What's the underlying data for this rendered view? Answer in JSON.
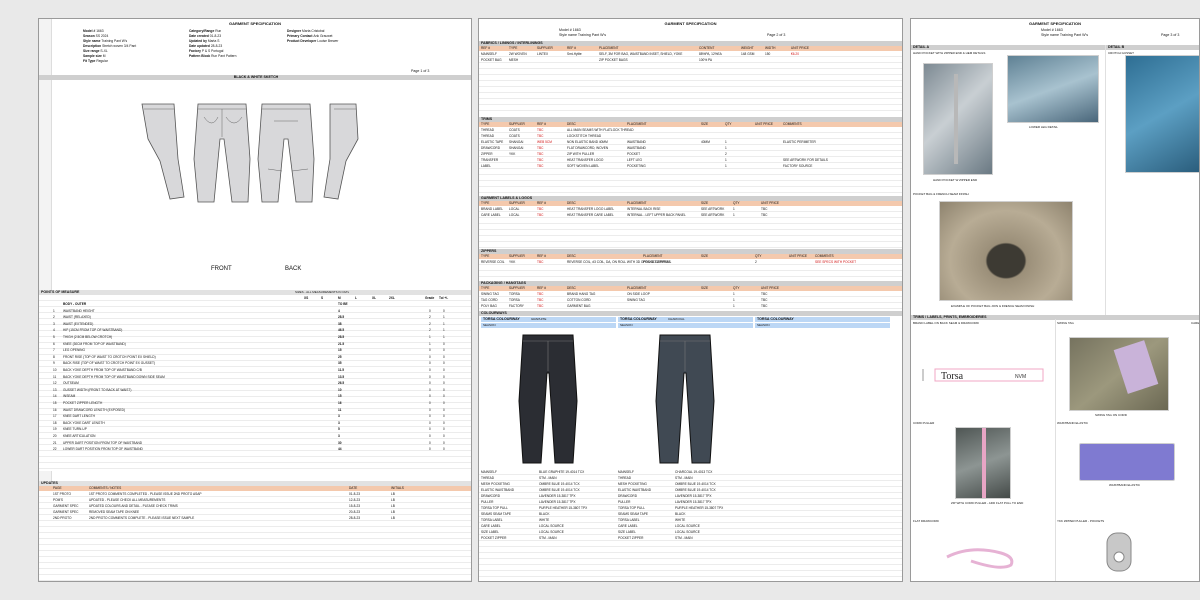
{
  "sheet1": {
    "title": "GARMENT SPECIFICATION",
    "meta": [
      {
        "label": "Model #",
        "value": "1663"
      },
      {
        "label": "Season",
        "value": "SS 2024"
      },
      {
        "label": "Style name",
        "value": "Training Pant W's"
      },
      {
        "label": "Description",
        "value": "Stretch woven 3/4 Pant"
      },
      {
        "label": "Size range",
        "value": "S-XL"
      },
      {
        "label": "Sample size",
        "value": "M"
      },
      {
        "label": "Fit Type",
        "value": "Regular"
      }
    ],
    "meta2": [
      {
        "label": "Category/Range",
        "value": "Run"
      },
      {
        "label": "Date created",
        "value": "01-8-23"
      },
      {
        "label": "Updated by",
        "value": "Marta S"
      },
      {
        "label": "Date updated",
        "value": "28-8-23"
      },
      {
        "label": "Factory",
        "value": "P & S Portugal"
      },
      {
        "label": "Pattern Block",
        "value": "Run Pant Pattern"
      }
    ],
    "meta3": [
      {
        "label": "Designer",
        "value": "Marta Cristobal"
      },
      {
        "label": "Primary Contact",
        "value": "Ank Grauwet"
      },
      {
        "label": "Product Developer",
        "value": "Louise Brewer"
      }
    ],
    "page": "Page 1 of 3",
    "sketch_title": "BLACK & WHITE SKETCH",
    "front_label": "FRONT",
    "back_label": "BACK",
    "pom_title": "POINTS OF MEASURE",
    "sizes_title": "SIZES - ALL MEASUREMENTS IN CM's",
    "size_headers": [
      "XS",
      "S",
      "M",
      "L",
      "XL",
      "2XL"
    ],
    "grade_header": "Grade",
    "tol_header": "Tol +/-",
    "pom_items": [
      {
        "n": "",
        "desc": "BODY - OUTER",
        "m": "TO BE",
        "g": "",
        "t": ""
      },
      {
        "n": "1",
        "desc": "WAISTBAND HEIGHT",
        "m": "4",
        "g": "0",
        "t": "0"
      },
      {
        "n": "2",
        "desc": "WAIST (RELAXED)",
        "m": "28.5",
        "g": "2",
        "t": "1"
      },
      {
        "n": "3",
        "desc": "WAIST (EXTENDED)",
        "m": "38",
        "g": "2",
        "t": "1"
      },
      {
        "n": "4",
        "desc": "HIP (15CM FROM TOP OF WAISTBAND)",
        "m": "46.5",
        "g": "2",
        "t": "1"
      },
      {
        "n": "5",
        "desc": "THIGH (2.5CM BELOW CROTCH)",
        "m": "28.5",
        "g": "1",
        "t": "1"
      },
      {
        "n": "6",
        "desc": "KNEE (30CM FROM TOP OF WAISTBAND)",
        "m": "21.5",
        "g": "1",
        "t": "0"
      },
      {
        "n": "7",
        "desc": "LEG OPENING",
        "m": "15",
        "g": "0",
        "t": "0"
      },
      {
        "n": "8",
        "desc": "FRONT RISE (TOP OF WAIST TO CROTCH POINT EX SHIELD)",
        "m": "25",
        "g": "0",
        "t": "0"
      },
      {
        "n": "9",
        "desc": "BACK RISE (TOP OF WAIST TO CROTCH POINT EX GUSSET)",
        "m": "35",
        "g": "0",
        "t": "0"
      },
      {
        "n": "10",
        "desc": "BACK YOKE DEPTH FROM TOP OF WAISTBAND C/B",
        "m": "11.5",
        "g": "0",
        "t": "0"
      },
      {
        "n": "11",
        "desc": "BACK YOKE DEPTH FROM TOP OF WAISTBAND DOWN SIDE SEAM",
        "m": "13.5",
        "g": "0",
        "t": "0"
      },
      {
        "n": "12",
        "desc": "OUTSEAM",
        "m": "26.5",
        "g": "0",
        "t": "0"
      },
      {
        "n": "13",
        "desc": "GUSSET WIDTH (FRONT TO BACK AT WAIST)",
        "m": "10",
        "g": "0",
        "t": "0"
      },
      {
        "n": "14",
        "desc": "INSEAM",
        "m": "15",
        "g": "0",
        "t": "0"
      },
      {
        "n": "15",
        "desc": "POCKET ZIPPER LENGTH",
        "m": "16",
        "g": "0",
        "t": "0"
      },
      {
        "n": "16",
        "desc": "WAIST DRAWCORD LENGTH (EXPOSED)",
        "m": "11",
        "g": "0",
        "t": "0"
      },
      {
        "n": "17",
        "desc": "KNEE DART LENGTH",
        "m": "3",
        "g": "0",
        "t": "0"
      },
      {
        "n": "18",
        "desc": "BACK YOKE DART LENGTH",
        "m": "3",
        "g": "0",
        "t": "0"
      },
      {
        "n": "19",
        "desc": "KNEE TURN-UP",
        "m": "5",
        "g": "0",
        "t": "0"
      },
      {
        "n": "20",
        "desc": "KNEE ARTICULATION",
        "m": "3",
        "g": "0",
        "t": "0"
      },
      {
        "n": "21",
        "desc": "UPPER DART POSITION FROM TOP OF WAISTBAND",
        "m": "30",
        "g": "0",
        "t": "0"
      },
      {
        "n": "22",
        "desc": "LOWER DART POSITION FROM TOP OF WAISTBAND",
        "m": "44",
        "g": "0",
        "t": "0"
      }
    ],
    "updates_title": "UPDATES",
    "updates_headers": [
      "PAGE",
      "COMMENTS / NOTES",
      "DATE",
      "INITIALS"
    ],
    "updates": [
      {
        "page": "1ST PROTO",
        "note": "1ST PROTO COMMENTS COMPLETED - PLEASE ISSUE 2ND PROTO ASAP",
        "date": "01-8-23",
        "init": "LB"
      },
      {
        "page": "POM'S",
        "note": "UPDATED - PLEASE CHECK ALL MEASUREMENTS",
        "date": "12-8-23",
        "init": "LB"
      },
      {
        "page": "GARMENT SPEC",
        "note": "UPDATED COLOURS AND DETAIL - PLEASE CHECK TRIMS",
        "date": "15-8-23",
        "init": "LB"
      },
      {
        "page": "GARMENT SPEC",
        "note": "REMOVED SEAM TAPE ON KNEE",
        "date": "20-8-23",
        "init": "LB"
      },
      {
        "page": "2ND PROTO",
        "note": "2ND PROTO COMMENTS COMPLETE - PLEASE ISSUE NEXT SAMPLE",
        "date": "28-8-23",
        "init": "LB"
      }
    ]
  },
  "sheet2": {
    "title": "GARMENT SPECIFICATION",
    "model": "Model # 1663",
    "style": "Style name Training Pant W's",
    "page": "Page 2 of 3",
    "fabrics_title": "FABRICS / LININGS / INTERLININGS",
    "fabric_headers": [
      "REF #",
      "TYPE",
      "SUPPLIER",
      "REF #",
      "PLACEMENT",
      "CONTENT",
      "WEIGHT",
      "WIDTH",
      "UNIT PRICE"
    ],
    "fabrics": [
      {
        "ref": "MAINSELF",
        "type": "2W WOVEN",
        "sup": "LINTEX",
        "ref2": "Smt-Hylite",
        "place": "SELF, 3M FOR BAG, WAISTBAND INSET, SHIELD, YOKE",
        "cont": "88%PA, 12%EA",
        "wt": "148 GSM",
        "w": "150",
        "p": "€6.20"
      },
      {
        "ref": "POCKET BAG",
        "type": "MESH",
        "sup": "",
        "ref2": "",
        "place": "ZIP POCKET BAGS",
        "cont": "100% PA",
        "wt": "",
        "w": "",
        "p": ""
      }
    ],
    "trims_title": "TRIMS",
    "trim_headers": [
      "TYPE",
      "SUPPLIER",
      "REF #",
      "DESC",
      "PLACEMENT",
      "SIZE",
      "QTY",
      "UNIT PRICE",
      "COMMENTS"
    ],
    "trims": [
      {
        "type": "THREAD",
        "sup": "COATS",
        "ref": "TBC",
        "desc": "ALL MAIN SEAMS WITH FLATLOCK THREAD",
        "place": "",
        "size": "",
        "qty": "",
        "price": "",
        "comm": ""
      },
      {
        "type": "THREAD",
        "sup": "COATS",
        "ref": "TBC",
        "desc": "LOCKSTITCH THREAD",
        "place": "",
        "size": "",
        "qty": "",
        "price": "",
        "comm": ""
      },
      {
        "type": "ELASTIC TAPE",
        "sup": "SHANGAI",
        "ref": "WEB 5CM",
        "desc": "NON ELASTIC BAND 40MM",
        "place": "WAISTBAND",
        "size": "40MM",
        "qty": "1",
        "price": "",
        "comm": "ELASTIC PERIMETER"
      },
      {
        "type": "DRAWCORD",
        "sup": "SHANGAI",
        "ref": "TBC",
        "desc": "FLAT DRAWCORD, WOVEN",
        "place": "WAISTBAND",
        "size": "",
        "qty": "1",
        "price": "",
        "comm": ""
      },
      {
        "type": "ZIPPER",
        "sup": "YKK",
        "ref": "TBC",
        "desc": "ZIP WITH PULLER",
        "place": "POCKET",
        "size": "",
        "qty": "2",
        "price": "",
        "comm": ""
      },
      {
        "type": "TRANSFER",
        "sup": "",
        "ref": "TBC",
        "desc": "HEAT TRANSFER LOGO",
        "place": "LEFT LEG",
        "size": "",
        "qty": "1",
        "price": "",
        "comm": "SEE ARTWORK FOR DETAILS"
      },
      {
        "type": "LABEL",
        "sup": "",
        "ref": "TBC",
        "desc": "SOFT WOVEN LABEL",
        "place": "POCKETING",
        "size": "",
        "qty": "1",
        "price": "",
        "comm": "FACTORY SOURCE"
      }
    ],
    "labels_title": "GARMENT LABELS & LOGOS",
    "label_headers": [
      "TYPE",
      "SUPPLIER",
      "REF #",
      "DESC",
      "PLACEMENT",
      "SIZE",
      "QTY",
      "UNIT PRICE"
    ],
    "labels": [
      {
        "type": "BRAND LABEL",
        "sup": "LOCAL",
        "ref": "TBC",
        "desc": "HEAT TRANSFER LOGO LABEL",
        "place": "INTERNAL BACK RISE",
        "size": "SEE ARTWORK",
        "qty": "1",
        "price": "TBC"
      },
      {
        "type": "CARE LABEL",
        "sup": "LOCAL",
        "ref": "TBC",
        "desc": "HEAT TRANSFER CARE LABEL",
        "place": "INTERNAL - LEFT UPPER BACK PANEL",
        "size": "SEE ARTWORK",
        "qty": "1",
        "price": "TBC"
      }
    ],
    "zips_title": "ZIPPERS",
    "zip_headers": [
      "TYPE",
      "SUPPLIER",
      "REF #",
      "DESC",
      "PLACEMENT",
      "SIZE",
      "QTY",
      "UNIT PRICE",
      "COMMENTS"
    ],
    "zips": [
      {
        "type": "REVERSE COIL",
        "sup": "YKK",
        "ref": "TBC",
        "desc": "REVERSE COIL, #3 COIL, DA, ON ROLL WITH 3D OPEN SLIDER/PULL",
        "place": "POCKET ZIPPERS",
        "size": "",
        "qty": "2",
        "price": "",
        "comm": "SEE SPECS WITH POCKET"
      }
    ],
    "pack_title": "PACKAGING / HANGTAGS",
    "pack_headers": [
      "TYPE",
      "SUPPLIER",
      "REF #",
      "DESC",
      "PLACEMENT",
      "SIZE",
      "QTY",
      "UNIT PRICE"
    ],
    "pack": [
      {
        "type": "SWING TAG",
        "sup": "TORSA",
        "ref": "TBC",
        "desc": "BRAND HANG TAG",
        "place": "ON SIDE LOOP",
        "size": "",
        "qty": "1",
        "price": "TBC"
      },
      {
        "type": "TAG CORD",
        "sup": "TORSA",
        "ref": "TBC",
        "desc": "COTTON CORD",
        "place": "SWING TAG",
        "size": "",
        "qty": "1",
        "price": "TBC"
      },
      {
        "type": "POLY BAG",
        "sup": "FACTORY",
        "ref": "TBC",
        "desc": "GARMENT BAG",
        "place": "",
        "size": "",
        "qty": "1",
        "price": "TBC"
      }
    ],
    "colour_title": "COLOURWAYS",
    "colourways": [
      {
        "name": "TORSA COLOURWAY",
        "code": "GRAPHITE",
        "season": "SEASON",
        "fill": "#2b2d33"
      },
      {
        "name": "TORSA COLOURWAY",
        "code": "CHARCOAL",
        "season": "SEASON",
        "fill": "#404953"
      },
      {
        "name": "TORSA COLOURWAY",
        "code": "",
        "season": "SEASON",
        "fill": ""
      }
    ],
    "colour_rows": [
      {
        "a": "MAINSELF",
        "b": "BLUE GRAPHITE 19-4014 TCX",
        "c": "MAINSELF",
        "d": "CHARCOAL 19-4013 TCX"
      },
      {
        "a": "THREAD",
        "b": "STM - MAIN",
        "c": "THREAD",
        "d": "STM - MAIN"
      },
      {
        "a": "MESH POCKETING",
        "b": "OMBRE BLUE 19-4014 TCX",
        "c": "MESH POCKETING",
        "d": "OMBRE BLUE 19-4014 TCX"
      },
      {
        "a": "ELASTIC WAISTBAND",
        "b": "OMBRE BLUE 19-4014 TCX",
        "c": "ELASTIC WAISTBAND",
        "d": "OMBRE BLUE 19-4014 TCX"
      },
      {
        "a": "DRAWCORD",
        "b": "LAVENDER 15-3817 TPX",
        "c": "DRAWCORD",
        "d": "LAVENDER 15-3817 TPX"
      },
      {
        "a": "PULLER",
        "b": "LAVENDER 15-3817 TPX",
        "c": "PULLER",
        "d": "LAVENDER 15-3817 TPX"
      },
      {
        "a": "TORSA TOP PULL",
        "b": "PURPLE HEATHER 15-3807 TPX",
        "c": "TORSA TOP PULL",
        "d": "PURPLE HEATHER 15-3807 TPX"
      },
      {
        "a": "SEAMS SEAM TAPE",
        "b": "BLACK",
        "c": "SEAMS SEAM TAPE",
        "d": "BLACK"
      },
      {
        "a": "TORSA LABEL",
        "b": "WHITE",
        "c": "TORSA LABEL",
        "d": "WHITE"
      },
      {
        "a": "CARE LABEL",
        "b": "LOCAL SOURCE",
        "c": "CARE LABEL",
        "d": "LOCAL SOURCE"
      },
      {
        "a": "SIZE LABEL",
        "b": "LOCAL SOURCE",
        "c": "SIZE LABEL",
        "d": "LOCAL SOURCE"
      },
      {
        "a": "POCKET ZIPPER",
        "b": "STM - MAIN",
        "c": "POCKET ZIPPER",
        "d": "STM - MAIN"
      }
    ]
  },
  "sheet3": {
    "title": "GARMENT SPECIFICATION",
    "model": "Model # 1663",
    "style": "Style name Training Pant W's",
    "page": "Page 3 of 3",
    "detail_a": "DETAIL A",
    "detail_b": "DETAIL B",
    "detail_a_sub": "HAND POCKET WITH ZIPPER END & HEM DETAILS",
    "detail_b_sub": "CROTCH GUSSET",
    "cap1": "HAND POCKET W ZIPPER END",
    "cap2": "LOWER LEG DETAIL",
    "pocket_title": "POCKET BAG & FRENCH SEAM FINISH",
    "cap3": "EXAMPLE OF POCKET BAG JOIN & FRENCH SEAM FINISH",
    "trims_title": "TRIMS / LABELS, PRINTS, EMBROIDERIES",
    "sub_a": "BRAND LABEL ON BACK SEAM & DRAWCORD",
    "sub_b": "SWING TAG",
    "sub_c": "CARE",
    "tag_brand": "Torsa",
    "cap4": "SWING TAG ON CORD",
    "cord_title": "CORD PULLER",
    "waist_title": "WAISTBAND ELASTIC",
    "cap5": "ZIP WITH CORD PULLER - ADD FLAT PULL TO END",
    "cap6": "WAISTBAND ELASTIC",
    "flat_title": "FLAT DRAWCORD",
    "puller_title": "YKK ZIPPER PULLER - POCKETS"
  },
  "colors": {
    "peach": "#f4c9ad",
    "yellow": "#fff47a",
    "green": "#e7f1c8",
    "blue": "#bcd7f5",
    "red": "#d01010"
  }
}
